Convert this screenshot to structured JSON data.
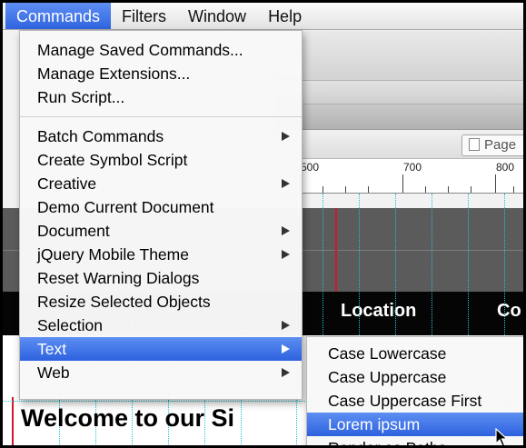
{
  "menubar": {
    "items": [
      "Commands",
      "Filters",
      "Window",
      "Help"
    ],
    "active_index": 0
  },
  "background_app": {
    "page_button_label": "Page",
    "ruler_numbers": [
      "500",
      "700",
      "800"
    ],
    "table_headers": [
      "Location",
      "Co"
    ],
    "heading_text": "Welcome to our Si"
  },
  "commands_menu": {
    "group1": [
      {
        "label": "Manage Saved Commands...",
        "submenu": false
      },
      {
        "label": "Manage Extensions...",
        "submenu": false
      },
      {
        "label": "Run Script...",
        "submenu": false
      }
    ],
    "group2": [
      {
        "label": "Batch Commands",
        "submenu": true
      },
      {
        "label": "Create Symbol Script",
        "submenu": false
      },
      {
        "label": "Creative",
        "submenu": true
      },
      {
        "label": "Demo Current Document",
        "submenu": false
      },
      {
        "label": "Document",
        "submenu": true
      },
      {
        "label": "jQuery Mobile Theme",
        "submenu": true
      },
      {
        "label": "Reset Warning Dialogs",
        "submenu": false
      },
      {
        "label": "Resize Selected Objects",
        "submenu": false
      },
      {
        "label": "Selection",
        "submenu": true
      },
      {
        "label": "Text",
        "submenu": true,
        "highlighted": true
      },
      {
        "label": "Web",
        "submenu": true
      }
    ]
  },
  "text_submenu": {
    "items": [
      {
        "label": "Case Lowercase"
      },
      {
        "label": "Case Uppercase"
      },
      {
        "label": "Case Uppercase First"
      },
      {
        "label": "Lorem ipsum",
        "highlighted": true
      },
      {
        "label": "Render as Paths"
      }
    ]
  },
  "colors": {
    "highlight": "#2f64e0",
    "guide": "#19c6d6",
    "red_guide": "#d0182a"
  }
}
